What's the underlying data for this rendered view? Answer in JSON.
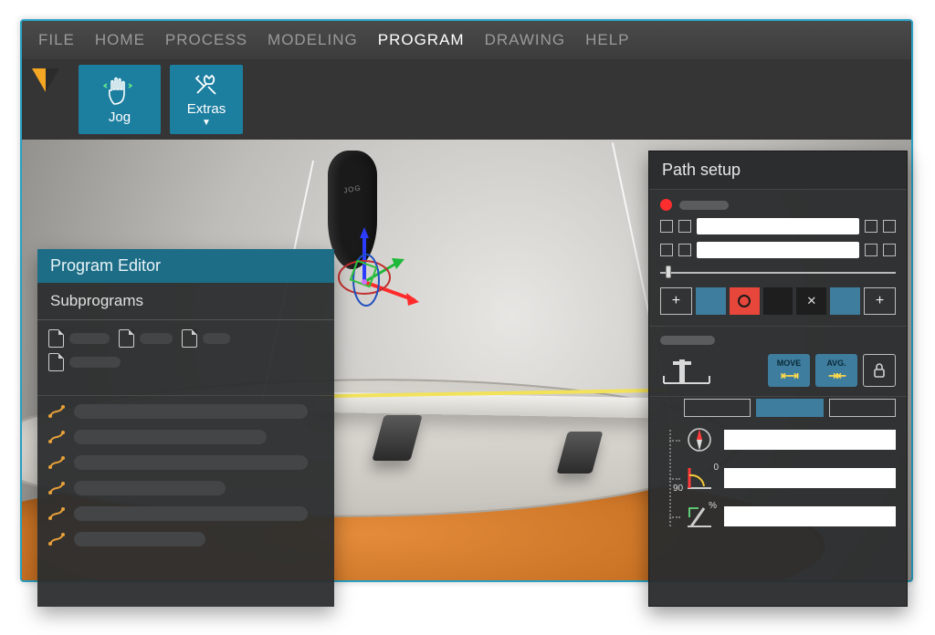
{
  "menu": {
    "items": [
      "FILE",
      "HOME",
      "PROCESS",
      "MODELING",
      "PROGRAM",
      "DRAWING",
      "HELP"
    ],
    "active_index": 4
  },
  "toolbar": {
    "jog_label": "Jog",
    "extras_label": "Extras"
  },
  "program_editor": {
    "title": "Program Editor",
    "subtitle": "Subprograms"
  },
  "path_setup": {
    "title": "Path setup",
    "mode_move_label": "MOVE",
    "mode_avg_label": "AVG.",
    "tilt_zero_label": "0",
    "tilt_ninety_label": "90",
    "percent_label": "%"
  },
  "colors": {
    "accent": "#1d7fa0",
    "blue_btn": "#3f7d9e",
    "red_btn": "#e7463a",
    "record": "#ff2e2e"
  }
}
